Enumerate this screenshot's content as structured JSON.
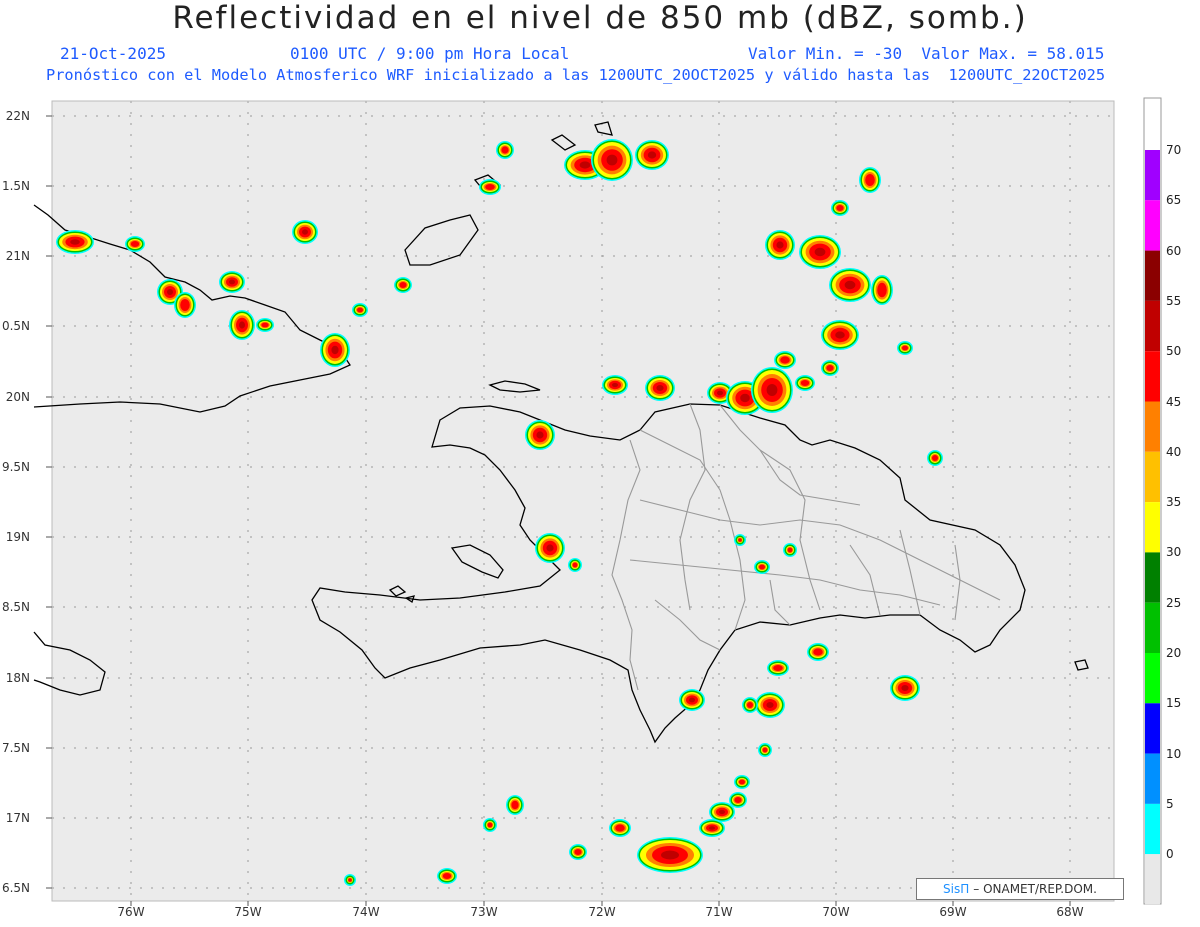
{
  "title": "Reflectividad en el nivel de 850 mb (dBZ, somb.)",
  "date": "21-Oct-2025",
  "time": "0100 UTC / 9:00 pm Hora Local",
  "range": "Valor Min. = -30  Valor Max. = 58.015",
  "forecast": "Pronóstico con el Modelo Atmosferico WRF inicializado a las 1200UTC_20OCT2025 y válido hasta las  1200UTC_22OCT2025",
  "credit": {
    "brand": "SisΠ",
    "text": " – ONAMET/REP.DOM."
  },
  "lat_labels": [
    "22N",
    "1.5N",
    "21N",
    "0.5N",
    "20N",
    "9.5N",
    "19N",
    "8.5N",
    "18N",
    "7.5N",
    "17N",
    "6.5N"
  ],
  "lon_labels": [
    "76W",
    "75W",
    "74W",
    "73W",
    "72W",
    "71W",
    "70W",
    "69W",
    "68W"
  ],
  "colorbar": {
    "labels": [
      "70",
      "65",
      "60",
      "55",
      "50",
      "45",
      "40",
      "35",
      "30",
      "25",
      "20",
      "15",
      "10",
      "5",
      "0"
    ],
    "colors": [
      "#a000ff",
      "#ff00ff",
      "#8b0000",
      "#c00000",
      "#ff0000",
      "#ff8000",
      "#ffc000",
      "#ffff00",
      "#008000",
      "#00c000",
      "#00ff00",
      "#0000ff",
      "#0090ff",
      "#00ffff",
      "#e8e8e8"
    ]
  },
  "map_colors": {
    "background": "#ebebeb",
    "coast": "#000000",
    "provinces": "#999999"
  }
}
